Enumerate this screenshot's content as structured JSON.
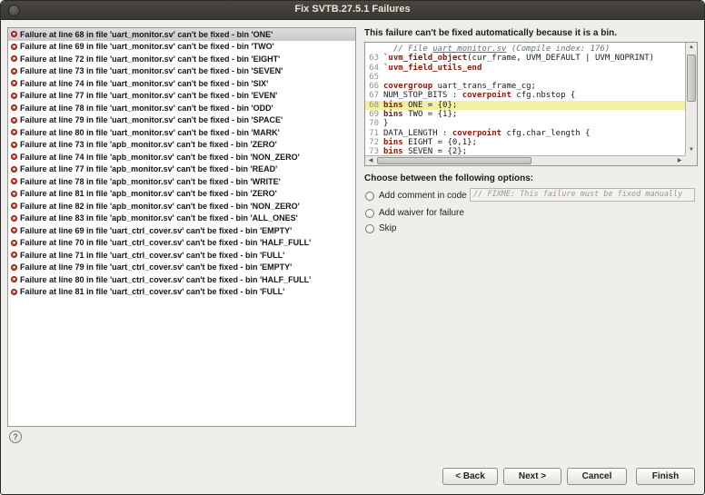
{
  "window": {
    "title": "Fix SVTB.27.5.1 Failures"
  },
  "message": "This failure can't be fixed automatically because it is a bin.",
  "failure_list": {
    "items": [
      {
        "label": "Failure at line 68 in file 'uart_monitor.sv' can't be fixed - bin 'ONE'",
        "selected": true
      },
      {
        "label": "Failure at line 69 in file 'uart_monitor.sv' can't be fixed - bin 'TWO'",
        "selected": false
      },
      {
        "label": "Failure at line 72 in file 'uart_monitor.sv' can't be fixed - bin 'EIGHT'",
        "selected": false
      },
      {
        "label": "Failure at line 73 in file 'uart_monitor.sv' can't be fixed - bin 'SEVEN'",
        "selected": false
      },
      {
        "label": "Failure at line 74 in file 'uart_monitor.sv' can't be fixed - bin 'SIX'",
        "selected": false
      },
      {
        "label": "Failure at line 77 in file 'uart_monitor.sv' can't be fixed - bin 'EVEN'",
        "selected": false
      },
      {
        "label": "Failure at line 78 in file 'uart_monitor.sv' can't be fixed - bin 'ODD'",
        "selected": false
      },
      {
        "label": "Failure at line 79 in file 'uart_monitor.sv' can't be fixed - bin 'SPACE'",
        "selected": false
      },
      {
        "label": "Failure at line 80 in file 'uart_monitor.sv' can't be fixed - bin 'MARK'",
        "selected": false
      },
      {
        "label": "Failure at line 73 in file 'apb_monitor.sv' can't be fixed - bin 'ZERO'",
        "selected": false
      },
      {
        "label": "Failure at line 74 in file 'apb_monitor.sv' can't be fixed - bin 'NON_ZERO'",
        "selected": false
      },
      {
        "label": "Failure at line 77 in file 'apb_monitor.sv' can't be fixed - bin 'READ'",
        "selected": false
      },
      {
        "label": "Failure at line 78 in file 'apb_monitor.sv' can't be fixed - bin 'WRITE'",
        "selected": false
      },
      {
        "label": "Failure at line 81 in file 'apb_monitor.sv' can't be fixed - bin 'ZERO'",
        "selected": false
      },
      {
        "label": "Failure at line 82 in file 'apb_monitor.sv' can't be fixed - bin 'NON_ZERO'",
        "selected": false
      },
      {
        "label": "Failure at line 83 in file 'apb_monitor.sv' can't be fixed - bin 'ALL_ONES'",
        "selected": false
      },
      {
        "label": "Failure at line 69 in file 'uart_ctrl_cover.sv' can't be fixed - bin 'EMPTY'",
        "selected": false
      },
      {
        "label": "Failure at line 70 in file 'uart_ctrl_cover.sv' can't be fixed - bin 'HALF_FULL'",
        "selected": false
      },
      {
        "label": "Failure at line 71 in file 'uart_ctrl_cover.sv' can't be fixed - bin 'FULL'",
        "selected": false
      },
      {
        "label": "Failure at line 79 in file 'uart_ctrl_cover.sv' can't be fixed - bin 'EMPTY'",
        "selected": false
      },
      {
        "label": "Failure at line 80 in file 'uart_ctrl_cover.sv' can't be fixed - bin 'HALF_FULL'",
        "selected": false
      },
      {
        "label": "Failure at line 81 in file 'uart_ctrl_cover.sv' can't be fixed - bin 'FULL'",
        "selected": false
      }
    ]
  },
  "code": {
    "lines": [
      {
        "num": "",
        "hl": false,
        "segs": [
          [
            "cmt",
            "  // File "
          ],
          [
            "link",
            "uart_monitor.sv"
          ],
          [
            "cmt",
            " (Compile index: 176)"
          ]
        ]
      },
      {
        "num": "63",
        "hl": false,
        "segs": [
          [
            "kw",
            "`uvm_field_object"
          ],
          [
            "pl",
            "(cur_frame, UVM_DEFAULT | UVM_NOPRINT)"
          ]
        ]
      },
      {
        "num": "64",
        "hl": false,
        "segs": [
          [
            "kw",
            "`uvm_field_utils_end"
          ]
        ]
      },
      {
        "num": "65",
        "hl": false,
        "segs": []
      },
      {
        "num": "66",
        "hl": false,
        "segs": [
          [
            "kw",
            "covergroup"
          ],
          [
            "pl",
            " uart_trans_frame_cg;"
          ]
        ]
      },
      {
        "num": "67",
        "hl": false,
        "segs": [
          [
            "pl",
            "NUM_STOP_BITS : "
          ],
          [
            "kw",
            "coverpoint"
          ],
          [
            "pl",
            " cfg.nbstop {"
          ]
        ]
      },
      {
        "num": "68",
        "hl": true,
        "segs": [
          [
            "kw",
            "bins"
          ],
          [
            "pl",
            " ONE = {0};"
          ]
        ]
      },
      {
        "num": "69",
        "hl": false,
        "segs": [
          [
            "kw",
            "bins"
          ],
          [
            "pl",
            " TWO = {1};"
          ]
        ]
      },
      {
        "num": "70",
        "hl": false,
        "segs": [
          [
            "pl",
            "}"
          ]
        ]
      },
      {
        "num": "71",
        "hl": false,
        "segs": [
          [
            "pl",
            "DATA_LENGTH : "
          ],
          [
            "kw",
            "coverpoint"
          ],
          [
            "pl",
            " cfg.char_length {"
          ]
        ]
      },
      {
        "num": "72",
        "hl": false,
        "segs": [
          [
            "kw",
            "bins"
          ],
          [
            "pl",
            " EIGHT = {0,1};"
          ]
        ]
      },
      {
        "num": "73",
        "hl": false,
        "segs": [
          [
            "kw",
            "bins"
          ],
          [
            "pl",
            " SEVEN = {2};"
          ]
        ]
      }
    ]
  },
  "options": {
    "prompt": "Choose between the following options:",
    "add_comment_label": "Add comment in code",
    "comment_text": "// FIXME: This failure must be fixed manually",
    "add_waiver_label": "Add waiver for failure",
    "skip_label": "Skip"
  },
  "buttons": {
    "back": "< Back",
    "next": "Next >",
    "cancel": "Cancel",
    "finish": "Finish"
  },
  "icons": {
    "up": "▲",
    "down": "▼",
    "left": "◀",
    "right": "▶",
    "help": "?"
  },
  "colors": {
    "keyword": "#8b1507",
    "comment": "#5e7183",
    "line_highlight": "#f5f0a0",
    "error_icon": "#cf3d2a",
    "titlebar": "#3d3c37"
  }
}
